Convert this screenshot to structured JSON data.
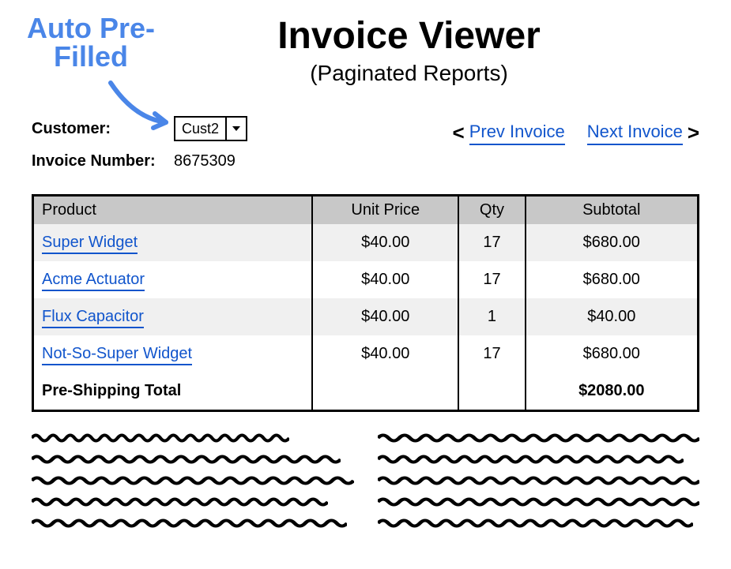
{
  "annotation": {
    "line1": "Auto Pre-",
    "line2": "Filled"
  },
  "title": "Invoice Viewer",
  "subtitle": "(Paginated Reports)",
  "labels": {
    "customer": "Customer:",
    "invoice_number": "Invoice Number:"
  },
  "customer": {
    "selected": "Cust2"
  },
  "invoice_number": "8675309",
  "pager": {
    "prev": "Prev Invoice",
    "next": "Next Invoice"
  },
  "table": {
    "headers": {
      "product": "Product",
      "unit_price": "Unit Price",
      "qty": "Qty",
      "subtotal": "Subtotal"
    },
    "rows": [
      {
        "product": "Super Widget",
        "unit_price": "$40.00",
        "qty": "17",
        "subtotal": "$680.00"
      },
      {
        "product": "Acme Actuator",
        "unit_price": "$40.00",
        "qty": "17",
        "subtotal": "$680.00"
      },
      {
        "product": "Flux Capacitor",
        "unit_price": "$40.00",
        "qty": "1",
        "subtotal": "$40.00"
      },
      {
        "product": "Not-So-Super Widget",
        "unit_price": "$40.00",
        "qty": "17",
        "subtotal": "$680.00"
      }
    ],
    "total": {
      "label": "Pre-Shipping Total",
      "value": "$2080.00"
    }
  }
}
